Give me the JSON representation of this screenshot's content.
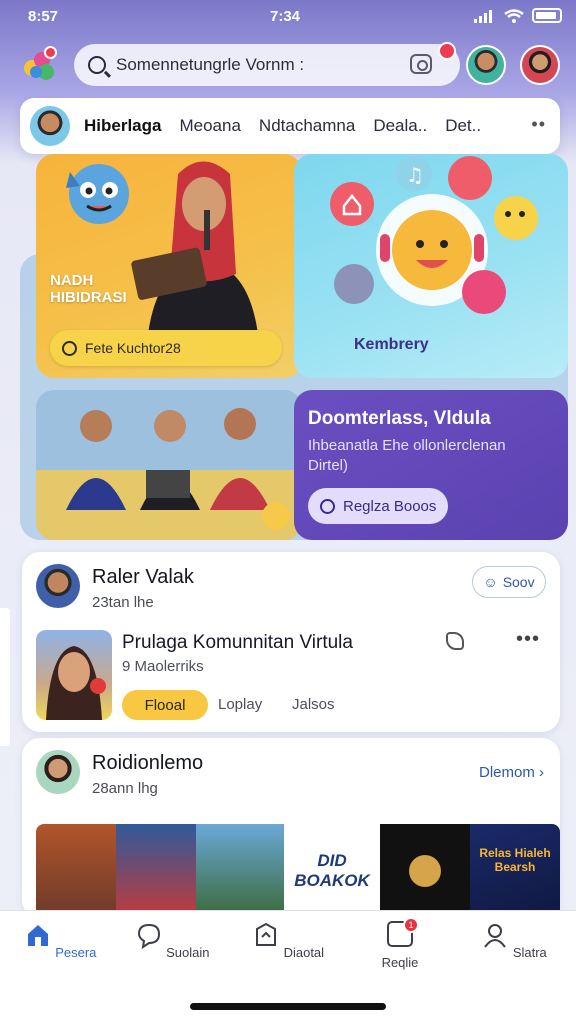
{
  "status_bar": {
    "time_left": "8:57",
    "time_center": "7:34"
  },
  "search": {
    "placeholder": "Somennetungrle Vornm :"
  },
  "categories": [
    "Hiberlaga",
    "Meoana",
    "Ndtachamna",
    "Deala..",
    "Det.."
  ],
  "hero": {
    "card_a_title_line1": "NADH",
    "card_a_title_line2": "HIBIDRASI",
    "card_a_pill": "Fete Kuchtor28",
    "card_b_caption": "Kembrery",
    "card_d_title": "Doomterlass, Vldula",
    "card_d_desc": "Ihbeanatla Ehe ollonlerclenan Dirtel)",
    "card_d_button": "Reglza Booos"
  },
  "feed": [
    {
      "author": "Raler Valak",
      "meta": "23tan lhe",
      "follow": "Soov",
      "community_title": "Prulaga Komunnitan Virtula",
      "community_sub": "9 Maolerriks",
      "join": "Flooal",
      "chip1": "Loplay",
      "chip2": "Jalsos"
    },
    {
      "author": "Roidionlemo",
      "meta": "28ann lhg",
      "more_link": "Dlemom",
      "tile_text_1": "DID",
      "tile_text_2": "BOAKOK",
      "tile_text_3": "Relas Hialeh Bearsh"
    }
  ],
  "bottom_nav": [
    {
      "label": "Pesera",
      "icon": "home-icon"
    },
    {
      "label": "Suolain",
      "icon": "chat-icon"
    },
    {
      "label": "Diaotal",
      "icon": "shield-icon"
    },
    {
      "label": "Reqlie",
      "icon": "notify-icon",
      "badge": "1"
    },
    {
      "label": "Slatra",
      "icon": "profile-icon"
    }
  ],
  "colors": {
    "accent": "#2f6ad0",
    "brand_yellow": "#f8c843",
    "purple": "#5a42b0",
    "badge_red": "#e8323f"
  }
}
